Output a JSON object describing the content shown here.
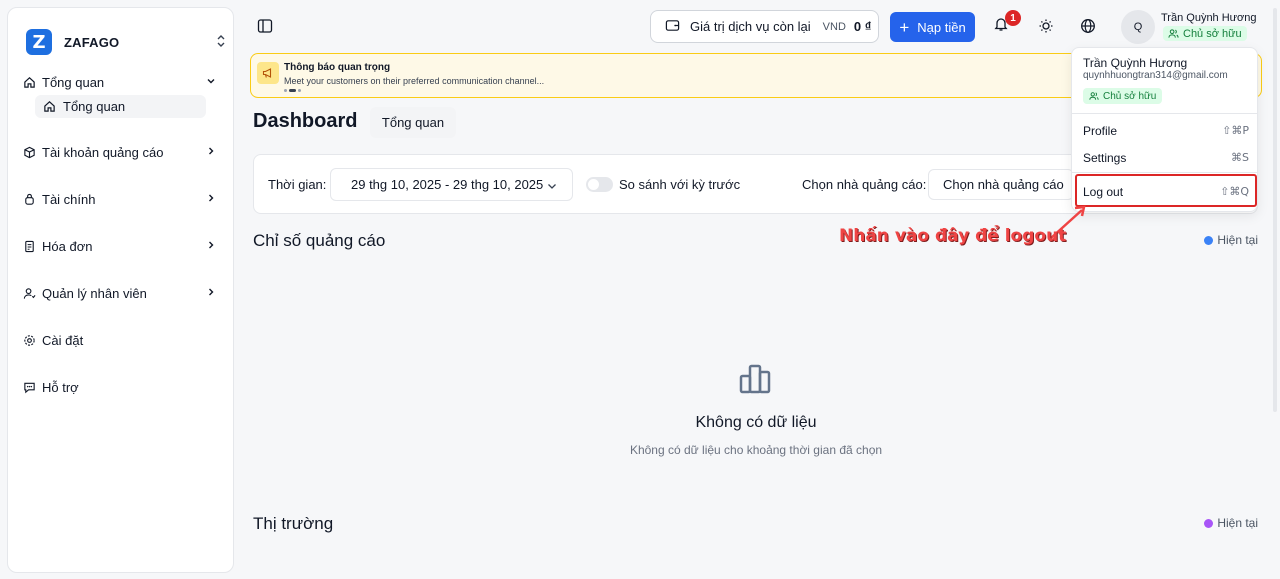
{
  "brand": {
    "name": "ZAFAGO",
    "logo_letter": "Z"
  },
  "sidebar": {
    "items": [
      {
        "label": "Tổng quan",
        "icon": "home-icon"
      },
      {
        "label": "Tài khoản quảng cáo",
        "icon": "box-icon"
      },
      {
        "label": "Tài chính",
        "icon": "wallet-icon"
      },
      {
        "label": "Hóa đơn",
        "icon": "receipt-icon"
      },
      {
        "label": "Quản lý nhân viên",
        "icon": "user-icon"
      },
      {
        "label": "Cài đặt",
        "icon": "gear-icon"
      },
      {
        "label": "Hỗ trợ",
        "icon": "message-icon"
      }
    ],
    "sub_item": {
      "label": "Tổng quan",
      "icon": "home-icon"
    }
  },
  "topbar": {
    "balance_label": "Giá trị dịch vụ còn lại",
    "currency": "VND",
    "balance_amount": "0 ₫",
    "topup_label": "Nạp tiền",
    "notification_count": "1",
    "avatar_initial": "Q",
    "user_name": "Trần Quỳnh Hương",
    "user_role": "Chủ sở hữu"
  },
  "notice": {
    "title": "Thông báo quan trọng",
    "text": "Meet your customers on their preferred communication channel..."
  },
  "page": {
    "title": "Dashboard",
    "tab": "Tổng quan"
  },
  "filter": {
    "time_label": "Thời gian:",
    "date_range": "29 thg 10, 2025 - 29 thg 10, 2025",
    "compare_label": "So sánh với kỳ trước",
    "advertiser_label": "Chọn nhà quảng cáo:",
    "advertiser_value": "Chọn nhà quảng cáo"
  },
  "sections": {
    "ad_metrics": {
      "title": "Chỉ số quảng cáo",
      "legend": "Hiện tại",
      "legend_color": "#3b82f6"
    },
    "market": {
      "title": "Thị trường",
      "legend": "Hiện tại",
      "legend_color": "#a855f7"
    }
  },
  "empty_state": {
    "title": "Không có dữ liệu",
    "description": "Không có dữ liệu cho khoảng thời gian đã chọn"
  },
  "dropdown": {
    "name": "Trần Quỳnh Hương",
    "email": "quynhhuongtran314@gmail.com",
    "role": "Chủ sở hữu",
    "profile_label": "Profile",
    "profile_shortcut": "⇧⌘P",
    "settings_label": "Settings",
    "settings_shortcut": "⌘S",
    "logout_label": "Log out",
    "logout_shortcut": "⇧⌘Q"
  },
  "annotation": {
    "text": "Nhấn vào đây để logout"
  }
}
